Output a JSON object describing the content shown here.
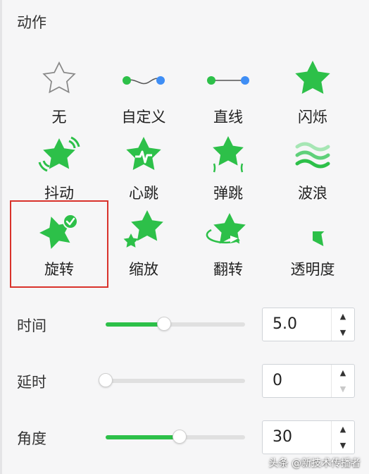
{
  "panel": {
    "title": "动作"
  },
  "colors": {
    "accent": "#2dc049",
    "accent_light": "#a6e6b4",
    "selected_border": "#d9322b",
    "connector_blue": "#3f8ef5"
  },
  "actions": [
    {
      "label": "无",
      "icon": "outline-star-icon"
    },
    {
      "label": "自定义",
      "icon": "custom-path-icon"
    },
    {
      "label": "直线",
      "icon": "straight-line-icon"
    },
    {
      "label": "闪烁",
      "icon": "flash-star-icon"
    },
    {
      "label": "抖动",
      "icon": "shake-star-icon"
    },
    {
      "label": "心跳",
      "icon": "heartbeat-star-icon"
    },
    {
      "label": "弹跳",
      "icon": "bounce-star-icon"
    },
    {
      "label": "波浪",
      "icon": "wave-icon"
    },
    {
      "label": "旋转",
      "icon": "rotate-star-icon",
      "selected": true
    },
    {
      "label": "缩放",
      "icon": "scale-star-icon"
    },
    {
      "label": "翻转",
      "icon": "flip-star-icon"
    },
    {
      "label": "透明度",
      "icon": "opacity-star-icon"
    }
  ],
  "controls": {
    "time": {
      "label": "时间",
      "value": "5.0",
      "slider_fraction": 0.42
    },
    "delay": {
      "label": "延时",
      "value": "0",
      "slider_fraction": 0.0
    },
    "angle": {
      "label": "角度",
      "value": "30",
      "slider_fraction": 0.53
    }
  },
  "spinner": {
    "up": "▲",
    "down": "▼"
  },
  "watermark": "头条 @新技术传播者"
}
